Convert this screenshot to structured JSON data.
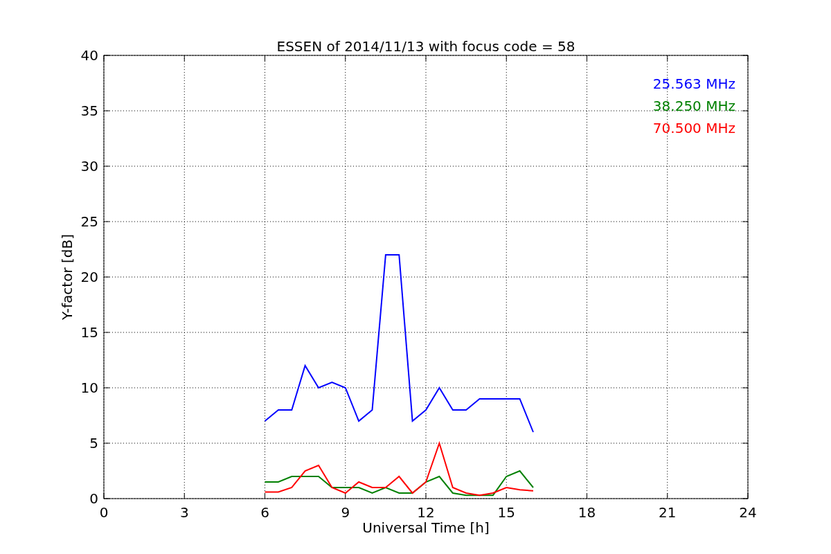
{
  "chart_data": {
    "type": "line",
    "title": "ESSEN of 2014/11/13 with focus code = 58",
    "xlabel": "Universal Time [h]",
    "ylabel": "Y-factor [dB]",
    "x": [
      6,
      6.5,
      7,
      7.5,
      8,
      8.5,
      9,
      9.5,
      10,
      10.5,
      11,
      11.5,
      12,
      12.5,
      13,
      13.5,
      14,
      14.5,
      15,
      15.5,
      16
    ],
    "series": [
      {
        "name": "25.563 MHz",
        "color": "#0000ff",
        "values": [
          7,
          8,
          8,
          12,
          10,
          10.5,
          10,
          7,
          8,
          22,
          22,
          7,
          8,
          10,
          8,
          8,
          9,
          9,
          9,
          9,
          6
        ]
      },
      {
        "name": "38.250 MHz",
        "color": "#008000",
        "values": [
          1.5,
          1.5,
          2,
          2,
          2,
          1,
          1,
          1,
          0.5,
          1,
          0.5,
          0.5,
          1.5,
          2,
          0.5,
          0.3,
          0.3,
          0.3,
          2,
          2.5,
          1
        ]
      },
      {
        "name": "70.500 MHz",
        "color": "#ff0000",
        "values": [
          0.6,
          0.6,
          1,
          2.5,
          3,
          1,
          0.5,
          1.5,
          1,
          1,
          2,
          0.5,
          1.5,
          5,
          1,
          0.5,
          0.3,
          0.5,
          1,
          0.8,
          0.7
        ]
      }
    ],
    "xlim": [
      0,
      24
    ],
    "ylim": [
      0,
      40
    ],
    "xticks": [
      0,
      3,
      6,
      9,
      12,
      15,
      18,
      21,
      24
    ],
    "yticks": [
      0,
      5,
      10,
      15,
      20,
      25,
      30,
      35,
      40
    ],
    "grid": true
  }
}
